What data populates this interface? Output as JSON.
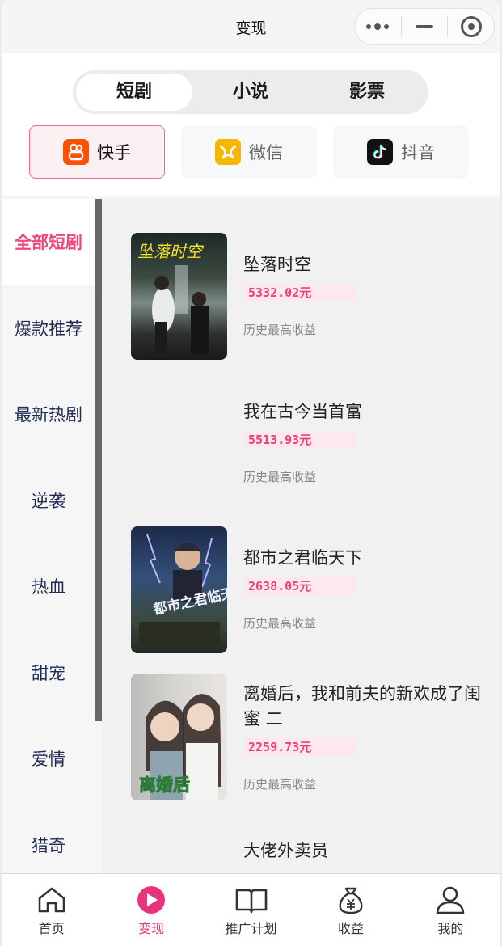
{
  "window": {
    "title": "变现"
  },
  "header": {
    "segments": [
      "短剧",
      "小说",
      "影票"
    ],
    "active_segment": 0,
    "platforms": [
      {
        "label": "快手",
        "icon": "kuaishou-icon",
        "color": "#ff5000"
      },
      {
        "label": "微信",
        "icon": "weixin-icon",
        "color": "#f7b500"
      },
      {
        "label": "抖音",
        "icon": "douyin-icon",
        "color": "#111111"
      }
    ],
    "active_platform": 0
  },
  "categories": [
    "全部短剧",
    "爆款推荐",
    "最新热剧",
    "逆袭",
    "热血",
    "甜宠",
    "爱情",
    "猎奇"
  ],
  "active_category": 0,
  "dramas": [
    {
      "title": "坠落时空",
      "price": "5332.02元",
      "subtitle": "历史最高收益",
      "cover_text": "坠落时空"
    },
    {
      "title": "我在古今当首富",
      "price": "5513.93元",
      "subtitle": "历史最高收益",
      "cover_text": ""
    },
    {
      "title": "都市之君临天下",
      "price": "2638.05元",
      "subtitle": "历史最高收益",
      "cover_text": "都市之君临天下"
    },
    {
      "title": "离婚后，我和前夫的新欢成了闺蜜 二",
      "price": "2259.73元",
      "subtitle": "历史最高收益",
      "cover_text": "离婚后"
    },
    {
      "title": "大佬外卖员",
      "price": "",
      "subtitle": "",
      "cover_text": ""
    }
  ],
  "tabbar": {
    "items": [
      {
        "label": "首页",
        "icon": "home-icon"
      },
      {
        "label": "变现",
        "icon": "play-icon"
      },
      {
        "label": "推广计划",
        "icon": "book-icon"
      },
      {
        "label": "收益",
        "icon": "money-bag-icon"
      },
      {
        "label": "我的",
        "icon": "user-icon"
      }
    ],
    "active": 1,
    "accent": "#e8347a"
  }
}
